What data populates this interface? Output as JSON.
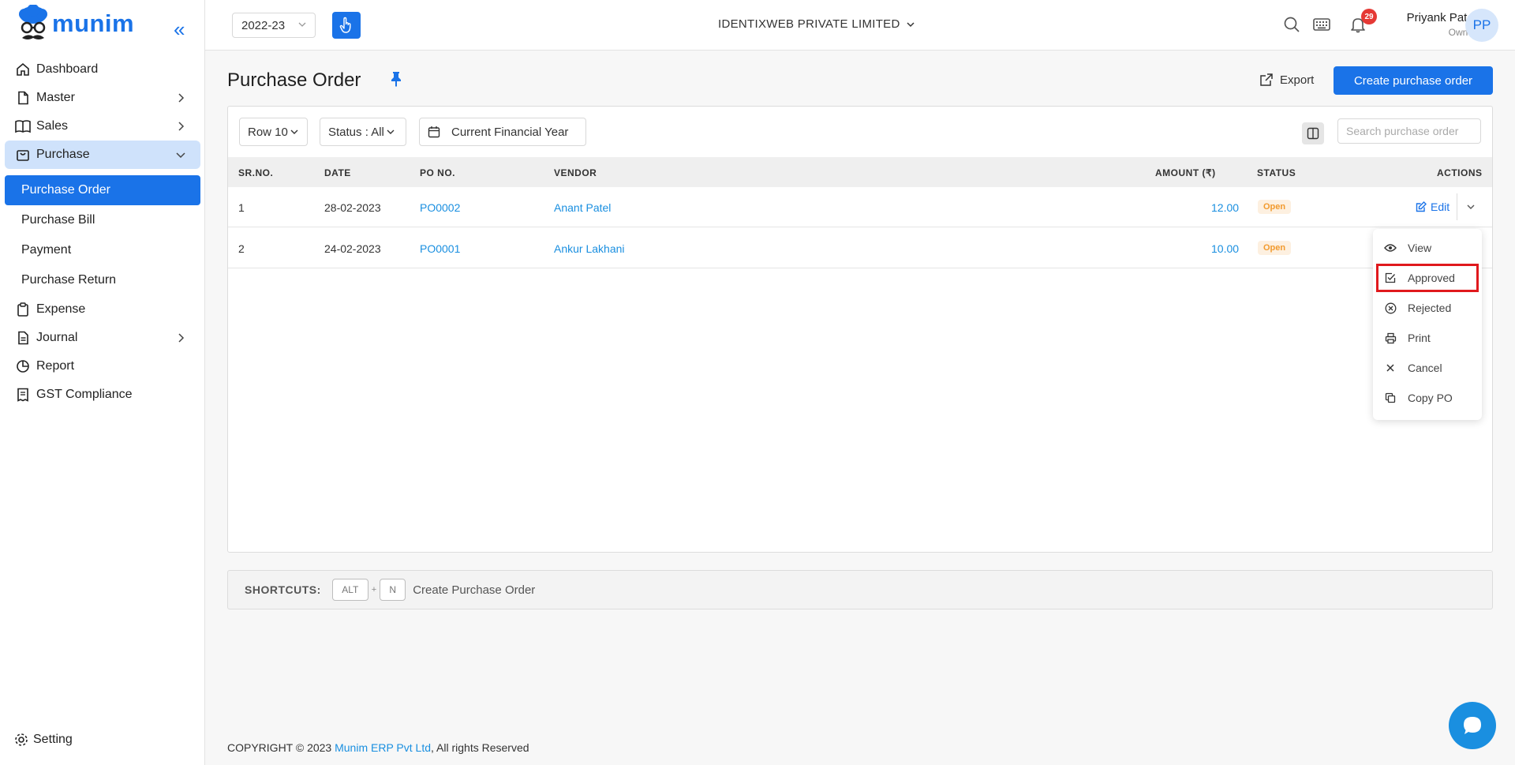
{
  "brand": {
    "name": "munim"
  },
  "sidebar": {
    "items": [
      {
        "label": "Dashboard"
      },
      {
        "label": "Master"
      },
      {
        "label": "Sales"
      },
      {
        "label": "Purchase"
      },
      {
        "label": "Expense"
      },
      {
        "label": "Journal"
      },
      {
        "label": "Report"
      },
      {
        "label": "GST Compliance"
      }
    ],
    "purchase_sub": [
      {
        "label": "Purchase Order"
      },
      {
        "label": "Purchase Bill"
      },
      {
        "label": "Payment"
      },
      {
        "label": "Purchase Return"
      }
    ],
    "setting_label": "Setting"
  },
  "topbar": {
    "year": "2022-23",
    "company": "IDENTIXWEB PRIVATE LIMITED",
    "notification_count": "29",
    "user_name": "Priyank Patel",
    "user_role": "Owner",
    "avatar_initials": "PP"
  },
  "page": {
    "title": "Purchase Order",
    "export_label": "Export",
    "create_label": "Create purchase order"
  },
  "filters": {
    "rows": "Row 10",
    "status": "Status : All",
    "period": "Current Financial Year",
    "search_placeholder": "Search purchase order"
  },
  "table": {
    "headers": {
      "sr": "SR.NO.",
      "date": "DATE",
      "po": "PO NO.",
      "vendor": "VENDOR",
      "amount": "AMOUNT (₹)",
      "status": "STATUS",
      "actions": "ACTIONS"
    },
    "rows": [
      {
        "sr": "1",
        "date": "28-02-2023",
        "po": "PO0002",
        "vendor": "Anant Patel",
        "amount": "12.00",
        "status": "Open"
      },
      {
        "sr": "2",
        "date": "24-02-2023",
        "po": "PO0001",
        "vendor": "Ankur Lakhani",
        "amount": "10.00",
        "status": "Open"
      }
    ],
    "edit_label": "Edit"
  },
  "action_menu": {
    "items": [
      {
        "label": "View"
      },
      {
        "label": "Approved"
      },
      {
        "label": "Rejected"
      },
      {
        "label": "Print"
      },
      {
        "label": "Cancel"
      },
      {
        "label": "Copy PO"
      }
    ]
  },
  "shortcuts": {
    "label": "SHORTCUTS:",
    "key1": "ALT",
    "plus": "+",
    "key2": "N",
    "description": "Create Purchase Order"
  },
  "footer": {
    "prefix": "COPYRIGHT © 2023",
    "company": "Munim ERP Pvt Ltd",
    "suffix": ", All rights Reserved"
  },
  "colors": {
    "accent": "#1a73e8",
    "link": "#1a8fe0",
    "status_open_bg": "#fdf0e0",
    "status_open_text": "#f29a2e",
    "highlight_border": "#e0191d"
  }
}
